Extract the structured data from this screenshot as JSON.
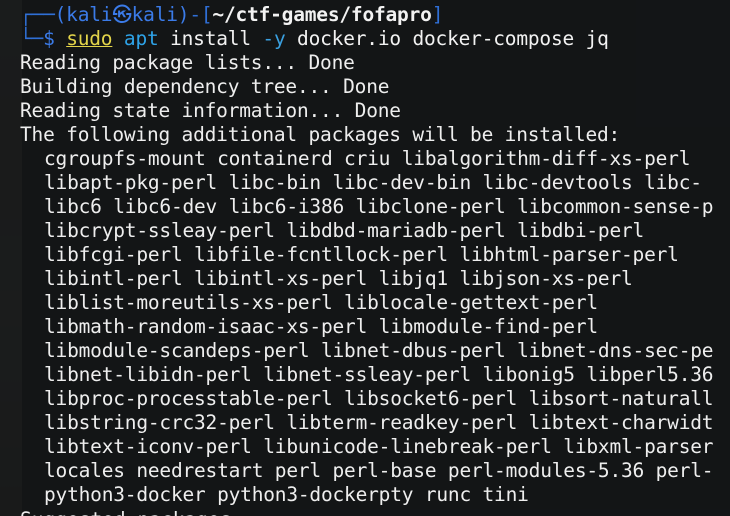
{
  "prompt": {
    "corner_top": "┌──",
    "user_host": "(kali㉿kali)",
    "sep": "-[",
    "path": "~/ctf-games/fofapro",
    "close": "]",
    "corner_bottom": "└─",
    "dollar": "$"
  },
  "command": {
    "sudo": "sudo",
    "apt": "apt",
    "install": "install",
    "flag": "-y",
    "pkg1": "docker.io",
    "pkg2": "docker-compose",
    "pkg3": "jq"
  },
  "output_lines": [
    "Reading package lists... Done",
    "Building dependency tree... Done",
    "Reading state information... Done",
    "The following additional packages will be installed:"
  ],
  "package_lines": [
    "cgroupfs-mount containerd criu libalgorithm-diff-xs-perl",
    "libapt-pkg-perl libc-bin libc-dev-bin libc-devtools libc-",
    "libc6 libc6-dev libc6-i386 libclone-perl libcommon-sense-p",
    "libcrypt-ssleay-perl libdbd-mariadb-perl libdbi-perl",
    "libfcgi-perl libfile-fcntllock-perl libhtml-parser-perl",
    "libintl-perl libintl-xs-perl libjq1 libjson-xs-perl",
    "liblist-moreutils-xs-perl liblocale-gettext-perl",
    "libmath-random-isaac-xs-perl libmodule-find-perl",
    "libmodule-scandeps-perl libnet-dbus-perl libnet-dns-sec-pe",
    "libnet-libidn-perl libnet-ssleay-perl libonig5 libperl5.36",
    "libproc-processtable-perl libsocket6-perl libsort-naturall",
    "libstring-crc32-perl libterm-readkey-perl libtext-charwidt",
    "libtext-iconv-perl libunicode-linebreak-perl libxml-parser",
    "locales needrestart perl perl-base perl-modules-5.36 perl-",
    "python3-docker python3-dockerpty runc tini"
  ],
  "trailing_line": "Suggested packages:"
}
